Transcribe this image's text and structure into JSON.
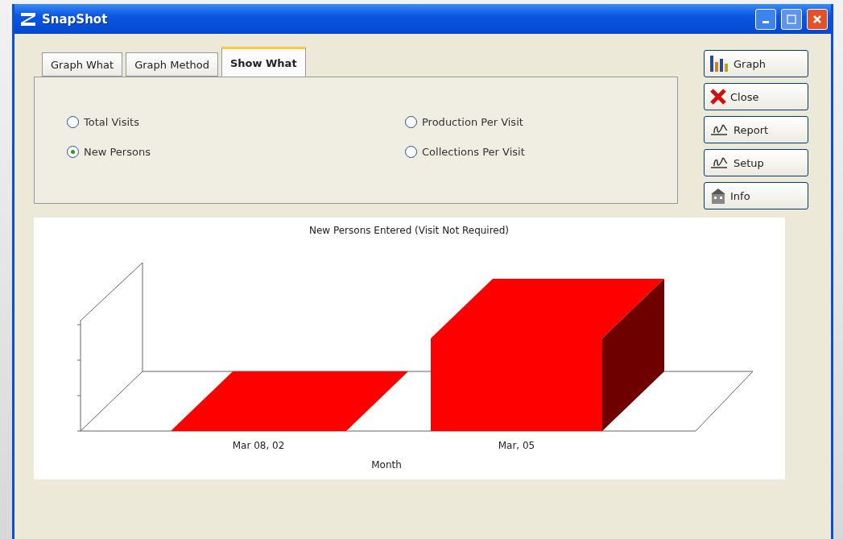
{
  "window": {
    "title": "SnapShot"
  },
  "tabs": [
    {
      "label": "Graph What",
      "selected": false
    },
    {
      "label": "Graph Method",
      "selected": false
    },
    {
      "label": "Show What",
      "selected": true
    }
  ],
  "options": [
    {
      "label": "Total Visits",
      "selected": false
    },
    {
      "label": "Production Per Visit",
      "selected": false
    },
    {
      "label": "New Persons",
      "selected": true
    },
    {
      "label": "Collections Per Visit",
      "selected": false
    }
  ],
  "buttons": [
    {
      "kind": "graph",
      "label": "Graph"
    },
    {
      "kind": "close",
      "label": "Close"
    },
    {
      "kind": "report",
      "label": "Report"
    },
    {
      "kind": "setup",
      "label": "Setup"
    },
    {
      "kind": "info",
      "label": "Info"
    }
  ],
  "chart": {
    "title": "New Persons Entered (Visit Not Required)",
    "axis_title": "Month",
    "category_labels": [
      "Mar 08, 02",
      "Mar, 05"
    ]
  }
}
